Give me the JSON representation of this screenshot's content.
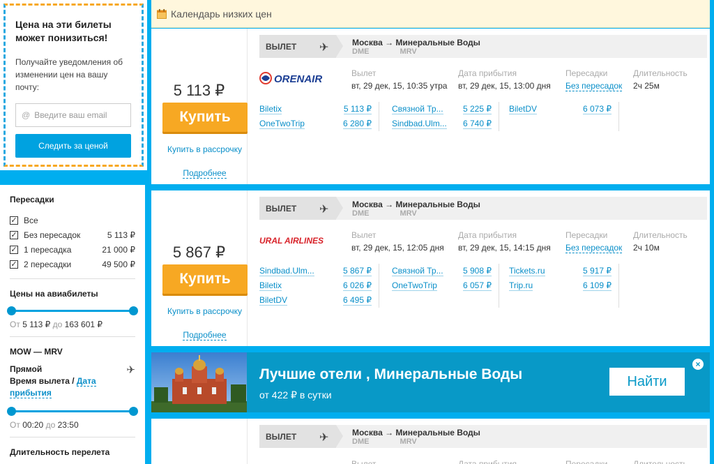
{
  "promo": {
    "title": "Цена на эти билеты может понизиться!",
    "text": "Получайте уведомления об изменении цен на вашу почту:",
    "email_placeholder": "Введите ваш email",
    "button": "Следить за ценой"
  },
  "filters": {
    "transfers_title": "Пересадки",
    "transfers": [
      {
        "label": "Все",
        "price": "",
        "checked": true
      },
      {
        "label": "Без пересадок",
        "price": "5 113 ₽",
        "checked": true
      },
      {
        "label": "1 пересадка",
        "price": "21 000 ₽",
        "checked": true
      },
      {
        "label": "2 пересадки",
        "price": "49 500 ₽",
        "checked": true
      }
    ],
    "prices_title": "Цены на авиабилеты",
    "price_from_word": "От",
    "price_from": "5 113 ₽",
    "price_to_word": "до",
    "price_to": "163 601 ₽",
    "route": "MOW — MRV",
    "direct": "Прямой",
    "departure_time": "Время вылета /",
    "arrival_link": "Дата прибытия",
    "time_from_word": "От",
    "time_from": "00:20",
    "time_to_word": "до",
    "time_to": "23:50",
    "duration_title": "Длительность перелета"
  },
  "calendar": {
    "label": "Календарь низких цен"
  },
  "labels": {
    "depart": "ВЫЛЕТ",
    "departure": "Вылет",
    "arrival": "Дата прибытия",
    "transfers": "Пересадки",
    "duration": "Длительность",
    "buy": "Купить",
    "credit": "Купить в рассрочку",
    "more": "Подробнее"
  },
  "tickets": [
    {
      "price": "5 113 ₽",
      "route": "Москва → Минеральные Воды",
      "from_code": "DME",
      "to_code": "MRV",
      "airline": "ORENAIR",
      "departure": "вт, 29 дек, 15, 10:35 утра",
      "arrival": "вт, 29 дек, 15, 13:00 дня",
      "transfers": "Без пересадок",
      "duration": "2ч 25м",
      "offers": [
        [
          {
            "agent": "Biletix",
            "price": "5 113 ₽"
          },
          {
            "agent": "OneTwoTrip",
            "price": "6 280 ₽"
          }
        ],
        [
          {
            "agent": "Связной Тр...",
            "price": "5 225 ₽"
          },
          {
            "agent": "Sindbad.Ulm...",
            "price": "6 740 ₽"
          }
        ],
        [
          {
            "agent": "BiletDV",
            "price": "6 073 ₽"
          }
        ]
      ]
    },
    {
      "price": "5 867 ₽",
      "route": "Москва → Минеральные Воды",
      "from_code": "DME",
      "to_code": "MRV",
      "airline": "URAL AIRLINES",
      "departure": "вт, 29 дек, 15, 12:05 дня",
      "arrival": "вт, 29 дек, 15, 14:15 дня",
      "transfers": "Без пересадок",
      "duration": "2ч 10м",
      "offers": [
        [
          {
            "agent": "Sindbad.Ulm...",
            "price": "5 867 ₽"
          },
          {
            "agent": "Biletix",
            "price": "6 026 ₽"
          },
          {
            "agent": "BiletDV",
            "price": "6 495 ₽"
          }
        ],
        [
          {
            "agent": "Связной Тр...",
            "price": "5 908 ₽"
          },
          {
            "agent": "OneTwoTrip",
            "price": "6 057 ₽"
          }
        ],
        [
          {
            "agent": "Tickets.ru",
            "price": "5 917 ₽"
          },
          {
            "agent": "Trip.ru",
            "price": "6 109 ₽"
          }
        ]
      ]
    },
    {
      "route": "Москва → Минеральные Воды",
      "from_code": "DME",
      "to_code": "MRV"
    }
  ],
  "ad": {
    "title": "Лучшие отели , Минеральные Воды",
    "subtitle": "от 422 ₽ в сутки",
    "button": "Найти",
    "close": "×"
  }
}
